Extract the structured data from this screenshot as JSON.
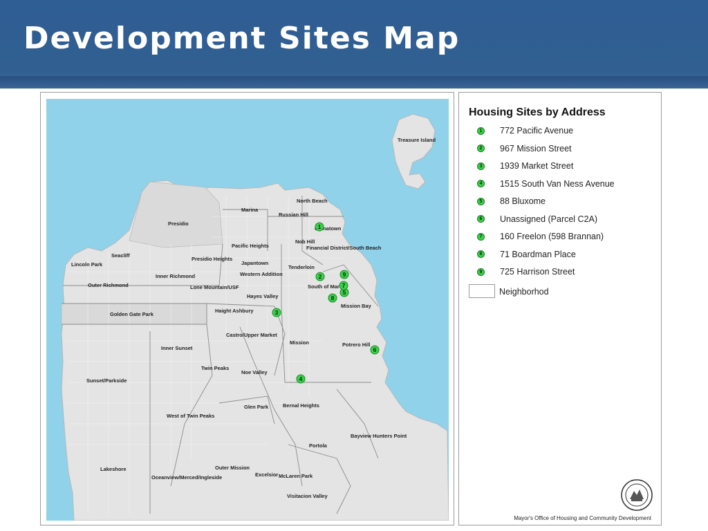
{
  "header": {
    "title": "Development Sites Map"
  },
  "map": {
    "neighborhoods": [
      {
        "name": "Treasure Island"
      },
      {
        "name": "North Beach"
      },
      {
        "name": "Marina"
      },
      {
        "name": "Russian Hill"
      },
      {
        "name": "Chinatown"
      },
      {
        "name": "Presidio"
      },
      {
        "name": "Nob Hill"
      },
      {
        "name": "Financial District/South Beach"
      },
      {
        "name": "Pacific Heights"
      },
      {
        "name": "Seacliff"
      },
      {
        "name": "Presidio Heights"
      },
      {
        "name": "Japantown"
      },
      {
        "name": "Lincoln Park"
      },
      {
        "name": "Tenderloin"
      },
      {
        "name": "Inner Richmond"
      },
      {
        "name": "Western Addition"
      },
      {
        "name": "Outer Richmond"
      },
      {
        "name": "Lone Mountain/USF"
      },
      {
        "name": "South of Market"
      },
      {
        "name": "Hayes Valley"
      },
      {
        "name": "Mission Bay"
      },
      {
        "name": "Haight Ashbury"
      },
      {
        "name": "Golden Gate Park"
      },
      {
        "name": "Castro/Upper Market"
      },
      {
        "name": "Mission"
      },
      {
        "name": "Potrero Hill"
      },
      {
        "name": "Inner Sunset"
      },
      {
        "name": "Twin Peaks"
      },
      {
        "name": "Noe Valley"
      },
      {
        "name": "Sunset/Parkside"
      },
      {
        "name": "Glen Park"
      },
      {
        "name": "Bernal Heights"
      },
      {
        "name": "West of Twin Peaks"
      },
      {
        "name": "Bayview Hunters Point"
      },
      {
        "name": "Portola"
      },
      {
        "name": "Lakeshore"
      },
      {
        "name": "Outer Mission"
      },
      {
        "name": "Excelsior"
      },
      {
        "name": "Oceanview/Merced/Ingleside"
      },
      {
        "name": "McLaren Park"
      },
      {
        "name": "Visitacion Valley"
      }
    ],
    "sites": [
      {
        "num": "1",
        "name": "772 Pacific Avenue"
      },
      {
        "num": "2",
        "name": "967 Mission Street"
      },
      {
        "num": "3",
        "name": "1939 Market Street"
      },
      {
        "num": "4",
        "name": "1515 South Van Ness Avenue"
      },
      {
        "num": "5",
        "name": "88 Bluxome"
      },
      {
        "num": "6",
        "name": "Unassigned (Parcel C2A)"
      },
      {
        "num": "7",
        "name": "160 Freelon (598 Brannan)"
      },
      {
        "num": "8",
        "name": "71 Boardman Place"
      },
      {
        "num": "9",
        "name": "725 Harrison Street"
      }
    ],
    "colors": {
      "water": "#8fd2ea",
      "land": "#e6e6e6",
      "marker": "#3bd14a"
    }
  },
  "legend": {
    "title": "Housing Sites by Address",
    "items": [
      {
        "num": "1",
        "label": "772 Pacific Avenue"
      },
      {
        "num": "2",
        "label": "967 Mission Street"
      },
      {
        "num": "3",
        "label": "1939 Market Street"
      },
      {
        "num": "4",
        "label": "1515 South Van Ness Avenue"
      },
      {
        "num": "5",
        "label": "88 Bluxome"
      },
      {
        "num": "6",
        "label": "Unassigned (Parcel C2A)"
      },
      {
        "num": "7",
        "label": "160 Freelon (598 Brannan)"
      },
      {
        "num": "8",
        "label": "71 Boardman Place"
      },
      {
        "num": "9",
        "label": "725 Harrison Street"
      }
    ],
    "neighborhood_label": "Neighborhod",
    "credit": "Mayor's Office of Housing and Community Development"
  }
}
